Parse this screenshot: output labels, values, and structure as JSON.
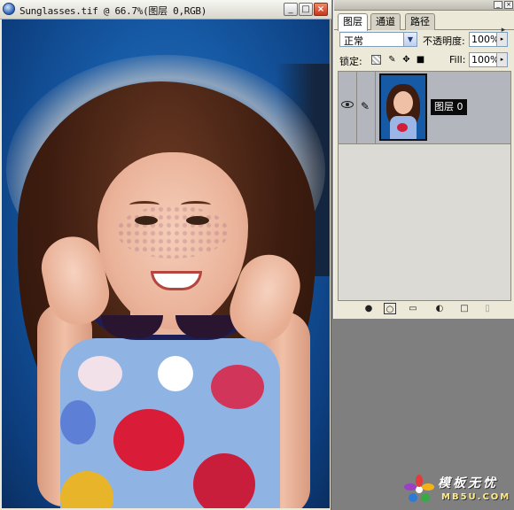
{
  "document": {
    "title": "Sunglasses.tif @ 66.7%(图层 0,RGB)",
    "buttons": {
      "minimize": "_",
      "maximize": "□",
      "close": "×"
    }
  },
  "layers_panel": {
    "tabs": [
      "图层",
      "通道",
      "路径"
    ],
    "active_tab": "图层",
    "blend_mode": "正常",
    "opacity_label": "不透明度:",
    "opacity_value": "100%",
    "lock_label": "锁定:",
    "fill_label": "Fill:",
    "fill_value": "100%",
    "layers": [
      {
        "name": "图层 0",
        "visible": true,
        "selected": true
      }
    ],
    "bottom_icons": [
      "link-style-icon",
      "add-mask-icon",
      "new-set-icon",
      "adjustment-layer-icon",
      "new-layer-icon",
      "delete-layer-icon"
    ]
  },
  "watermark": {
    "chinese": "模板无忧",
    "english": "MB5U.COM"
  }
}
